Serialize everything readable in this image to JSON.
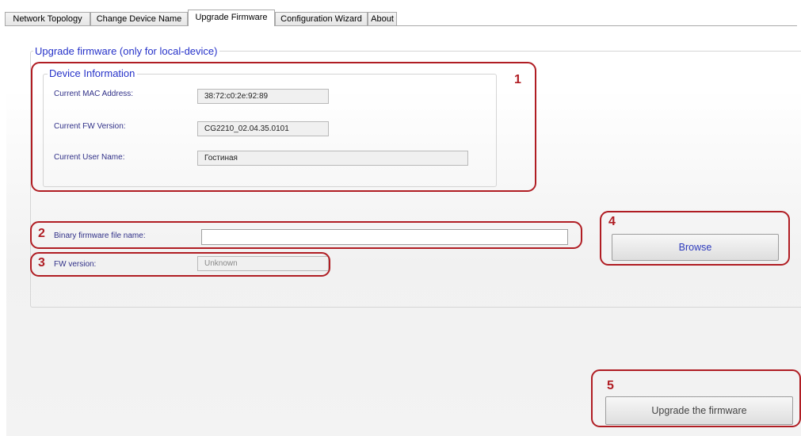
{
  "tabs": [
    {
      "label": "Network Topology",
      "active": false
    },
    {
      "label": "Change Device Name",
      "active": false
    },
    {
      "label": "Upgrade Firmware",
      "active": true
    },
    {
      "label": "Configuration Wizard",
      "active": false
    },
    {
      "label": "About",
      "active": false
    }
  ],
  "upgrade_group": {
    "title": "Upgrade firmware (only for local-device)"
  },
  "device_info": {
    "title": "Device Information",
    "mac_label": "Current MAC Address:",
    "mac_value": "38:72:c0:2e:92:89",
    "fw_label": "Current FW Version:",
    "fw_value": "CG2210_02.04.35.0101",
    "user_label": "Current User Name:",
    "user_value": "Гостиная"
  },
  "firmware_file": {
    "label": "Binary firmware file name:",
    "value": ""
  },
  "fw_version": {
    "label": "FW version:",
    "value": "Unknown"
  },
  "buttons": {
    "browse": "Browse",
    "upgrade": "Upgrade the firmware"
  },
  "callouts": [
    "1",
    "2",
    "3",
    "4",
    "5"
  ],
  "colors": {
    "callout": "#b01d23",
    "group_title": "#2632c9",
    "field_label": "#303088"
  }
}
